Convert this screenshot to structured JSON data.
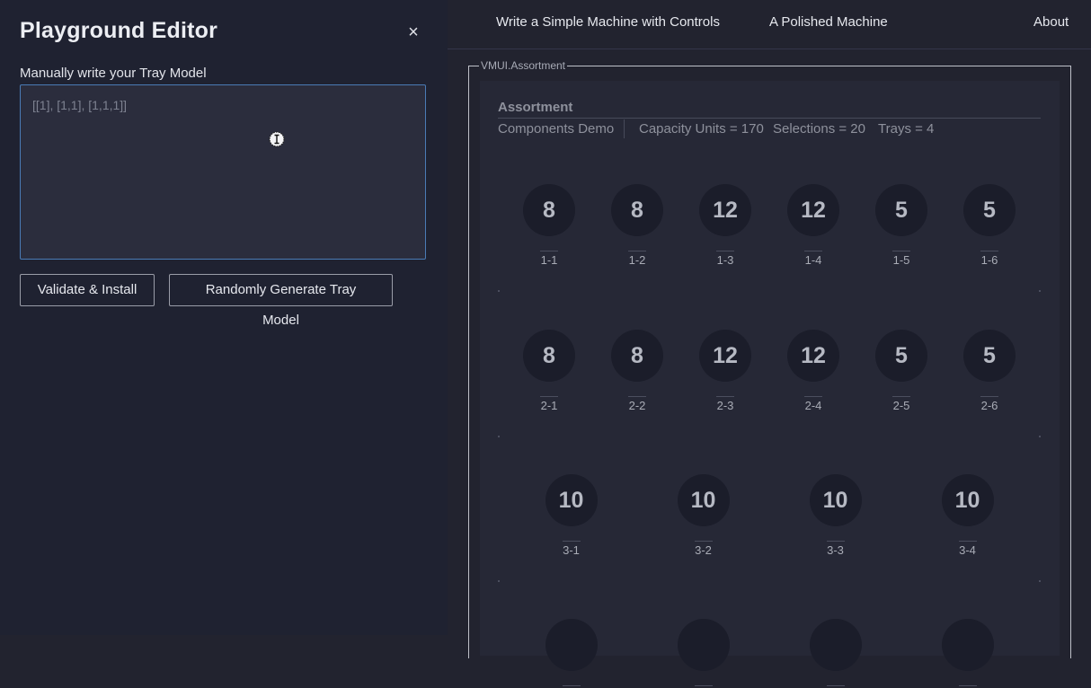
{
  "editor": {
    "title": "Playground Editor",
    "close_label": "×",
    "field_label": "Manually write your Tray Model",
    "placeholder": "[[1], [1,1], [1,1,1]]",
    "validate_label": "Validate & Install",
    "random_label": "Randomly Generate Tray Model"
  },
  "nav": {
    "link1": "Write a Simple Machine with Controls",
    "link2": "A Polished Machine",
    "link3": "About"
  },
  "panel": {
    "legend": "VMUI.Assortment",
    "title": "Assortment",
    "subtitle": "Components Demo",
    "capacity": "Capacity Units = 170",
    "selections": "Selections = 20",
    "trays": "Trays = 4"
  },
  "trays": [
    [
      {
        "value": "8",
        "label": "1-1"
      },
      {
        "value": "8",
        "label": "1-2"
      },
      {
        "value": "12",
        "label": "1-3"
      },
      {
        "value": "12",
        "label": "1-4"
      },
      {
        "value": "5",
        "label": "1-5"
      },
      {
        "value": "5",
        "label": "1-6"
      }
    ],
    [
      {
        "value": "8",
        "label": "2-1"
      },
      {
        "value": "8",
        "label": "2-2"
      },
      {
        "value": "12",
        "label": "2-3"
      },
      {
        "value": "12",
        "label": "2-4"
      },
      {
        "value": "5",
        "label": "2-5"
      },
      {
        "value": "5",
        "label": "2-6"
      }
    ],
    [
      {
        "value": "10",
        "label": "3-1"
      },
      {
        "value": "10",
        "label": "3-2"
      },
      {
        "value": "10",
        "label": "3-3"
      },
      {
        "value": "10",
        "label": "3-4"
      }
    ],
    [
      {
        "value": "",
        "label": ""
      },
      {
        "value": "",
        "label": ""
      },
      {
        "value": "",
        "label": ""
      },
      {
        "value": "",
        "label": ""
      }
    ]
  ]
}
